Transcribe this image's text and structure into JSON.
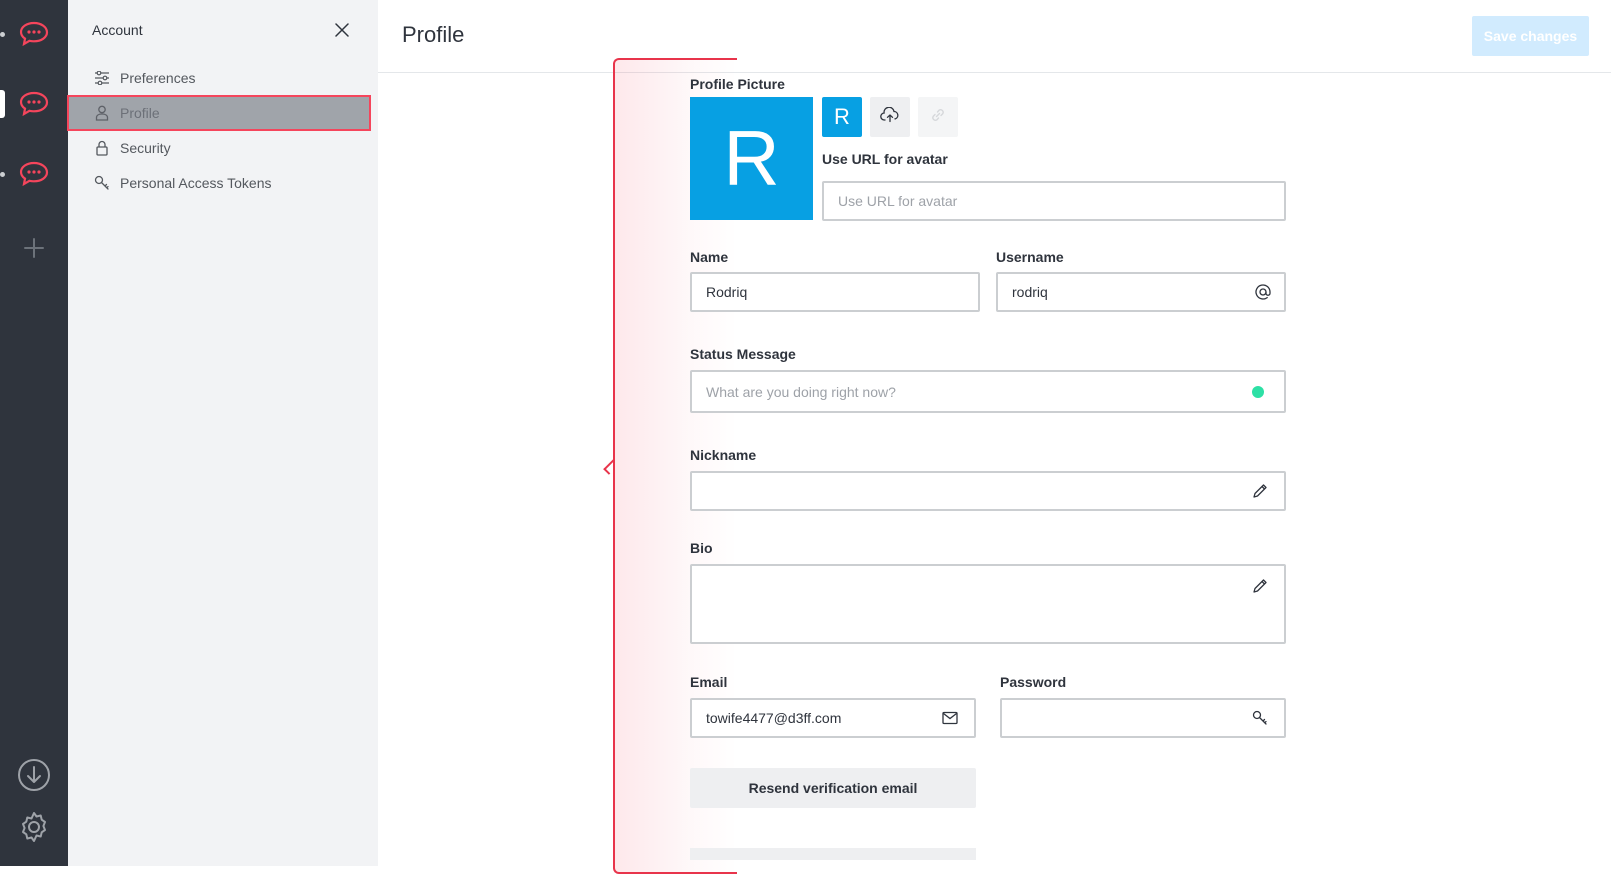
{
  "sidebar": {
    "title": "Account",
    "items": [
      {
        "label": "Preferences",
        "icon": "sliders-icon"
      },
      {
        "label": "Profile",
        "icon": "user-icon"
      },
      {
        "label": "Security",
        "icon": "lock-icon"
      },
      {
        "label": "Personal Access Tokens",
        "icon": "key-icon"
      }
    ]
  },
  "header": {
    "title": "Profile",
    "save_label": "Save changes"
  },
  "form": {
    "profile_picture_label": "Profile Picture",
    "avatar_letter": "R",
    "use_url_label": "Use URL for avatar",
    "use_url_placeholder": "Use URL for avatar",
    "name_label": "Name",
    "name_value": "Rodriq",
    "username_label": "Username",
    "username_value": "rodriq",
    "status_label": "Status Message",
    "status_placeholder": "What are you doing right now?",
    "nickname_label": "Nickname",
    "bio_label": "Bio",
    "email_label": "Email",
    "email_value": "towife4477@d3ff.com",
    "password_label": "Password",
    "resend_label": "Resend verification email"
  },
  "colors": {
    "rail_bg": "#2f343d",
    "brand_red": "#f5455c",
    "avatar_blue": "#07a0e3",
    "status_online": "#2de0a5",
    "save_disabled": "#d1ebfe"
  }
}
